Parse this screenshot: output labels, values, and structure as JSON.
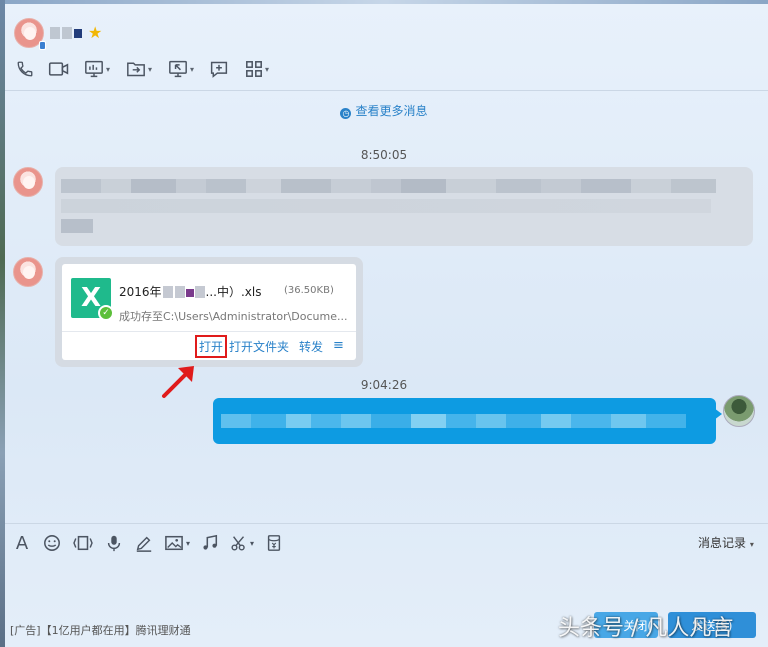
{
  "window": {
    "contact_name_visible": ""
  },
  "toolbar_top": {
    "icons": [
      "phone-icon",
      "video-icon",
      "screen-share-icon",
      "file-transfer-icon",
      "remote-assist-icon",
      "comment-icon",
      "apps-grid-icon"
    ]
  },
  "chat": {
    "more_messages": "查看更多消息",
    "time1": "8:50:05",
    "time2": "9:04:26",
    "file": {
      "name_prefix": "2016年",
      "name_suffix": "...中）.xls",
      "size": "(36.50KB)",
      "path": "成功存至C:\\Users\\Administrator\\Docume...",
      "action_open": "打开",
      "action_open_folder": "打开文件夹",
      "action_forward": "转发",
      "action_menu": "≡"
    }
  },
  "toolbar_bottom": {
    "history_label": "消息记录",
    "history_caret": "▾"
  },
  "footer": {
    "ad_text": "[广告]【1亿用户都在用】腾讯理财通",
    "close_label": "关闭(",
    "send_label": "发送(S)",
    "watermark": "头条号 / 凡人凡言"
  },
  "colors": {
    "accent_blue": "#2a82c9",
    "bubble_blue": "#0d9be2",
    "bubble_gray": "#d7dde5",
    "xls_green": "#1fba8c",
    "highlight_red": "#e01b1b"
  }
}
